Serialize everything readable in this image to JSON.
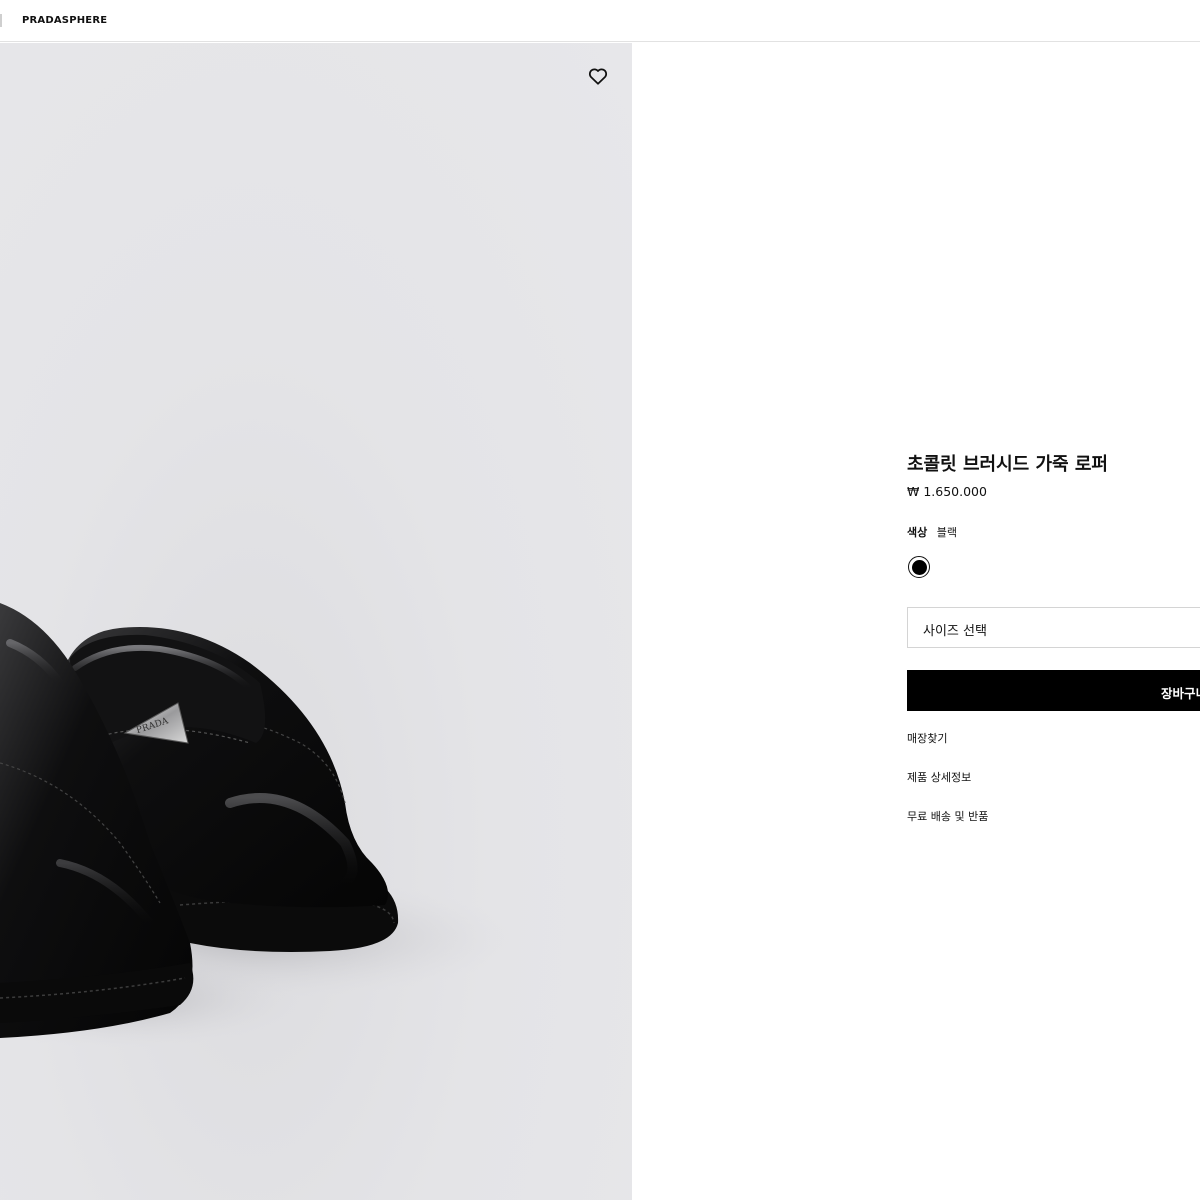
{
  "header": {
    "nav_link": "PRADASPHERE"
  },
  "product": {
    "title": "초콜릿 브러시드 가죽 로퍼",
    "price": "₩ 1.650.000",
    "color_label": "색상",
    "color_value": "블랙",
    "swatch_color": "#000000",
    "size_select_placeholder": "사이즈 선택",
    "add_to_cart_label": "장바구니에 담기",
    "links": {
      "find_store": "매장찾기",
      "product_details": "제품 상세정보",
      "shipping_returns": "무료 배송 및 반품"
    },
    "image_logo_text": "PRADA"
  },
  "icons": {
    "wishlist": "heart-icon"
  },
  "colors": {
    "gallery_background": "#e6e6e9",
    "button_background": "#000000",
    "button_text": "#ffffff"
  }
}
